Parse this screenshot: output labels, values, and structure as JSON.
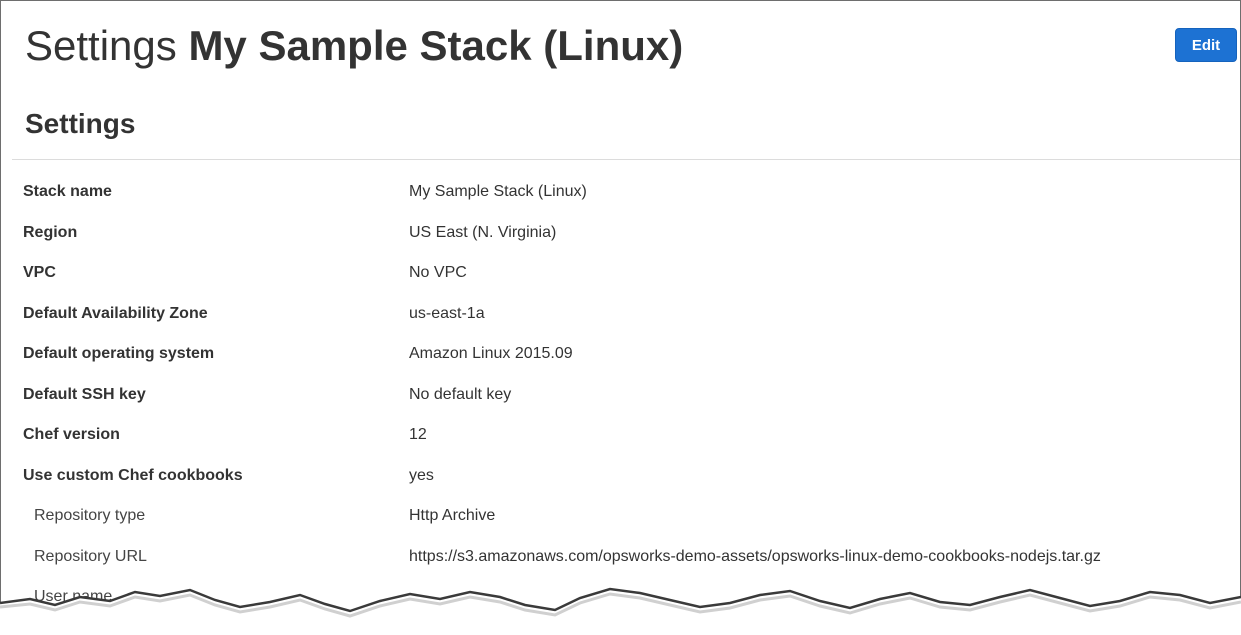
{
  "header": {
    "title_prefix": "Settings",
    "stack_name": "My Sample Stack (Linux)",
    "edit_label": "Edit"
  },
  "section": {
    "heading": "Settings"
  },
  "settings": [
    {
      "label": "Stack name",
      "value": "My Sample Stack (Linux)",
      "sub": false
    },
    {
      "label": "Region",
      "value": "US East (N. Virginia)",
      "sub": false
    },
    {
      "label": "VPC",
      "value": "No VPC",
      "sub": false
    },
    {
      "label": "Default Availability Zone",
      "value": "us-east-1a",
      "sub": false
    },
    {
      "label": "Default operating system",
      "value": "Amazon Linux 2015.09",
      "sub": false
    },
    {
      "label": "Default SSH key",
      "value": "No default key",
      "sub": false
    },
    {
      "label": "Chef version",
      "value": "12",
      "sub": false
    },
    {
      "label": "Use custom Chef cookbooks",
      "value": "yes",
      "sub": false
    },
    {
      "label": "Repository type",
      "value": "Http Archive",
      "sub": true
    },
    {
      "label": "Repository URL",
      "value": "https://s3.amazonaws.com/opsworks-demo-assets/opsworks-linux-demo-cookbooks-nodejs.tar.gz",
      "sub": true
    },
    {
      "label": "User name",
      "value": "–",
      "sub": true
    }
  ],
  "colors": {
    "button_blue": "#1d72d3",
    "text": "#333333",
    "divider": "#dcdcdc"
  }
}
